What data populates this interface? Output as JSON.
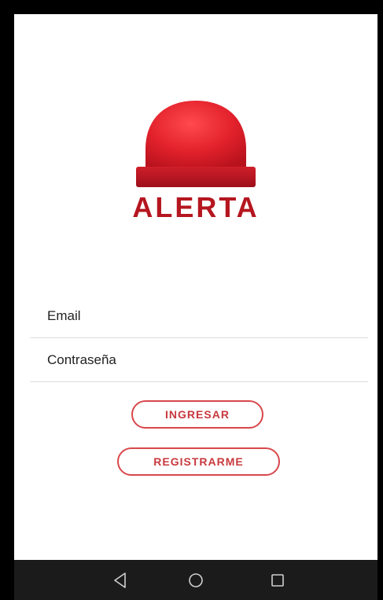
{
  "app": {
    "logo_text": "ALERTA",
    "logo_icon": "siren-icon",
    "brand_color": "#d42a33"
  },
  "form": {
    "email_placeholder": "Email",
    "password_placeholder": "Contraseña"
  },
  "actions": {
    "login_label": "INGRESAR",
    "register_label": "REGISTRARME"
  },
  "navbar": {
    "back_icon": "back-triangle-icon",
    "home_icon": "home-circle-icon",
    "recent_icon": "recent-apps-square-icon"
  }
}
